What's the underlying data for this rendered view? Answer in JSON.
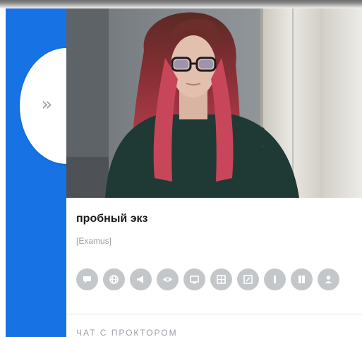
{
  "sidebar": {
    "toggle_symbol": "»",
    "accent_color": "#1773e4"
  },
  "video": {
    "description_icon": "webcam-feed"
  },
  "exam": {
    "title": "пробный экз",
    "org": "[Examus]"
  },
  "status_icons": [
    "chat-icon",
    "globe-icon",
    "megaphone-icon",
    "eye-icon",
    "screen-icon",
    "grid-icon",
    "edit-icon",
    "person-icon",
    "book-icon",
    "user-icon"
  ],
  "chat": {
    "label": "ЧАТ С ПРОКТОРОМ"
  }
}
